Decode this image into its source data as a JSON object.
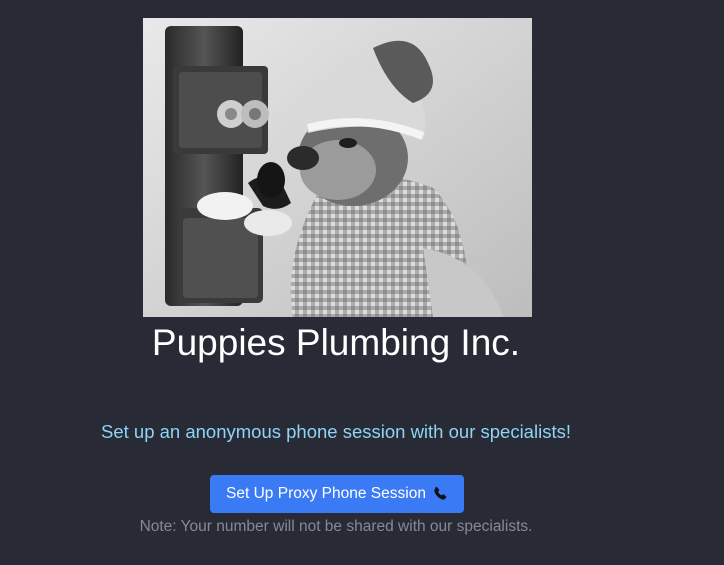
{
  "brand": {
    "title": "Puppies Plumbing Inc."
  },
  "hero": {
    "image_description_icon": "vintage-photo-dog-on-phone"
  },
  "main": {
    "tagline": "Set up an anonymous phone session with our specialists!",
    "button_label": "Set Up Proxy Phone Session",
    "button_icon": "phone-icon",
    "note": "Note: Your number will not be shared with our specialists."
  },
  "colors": {
    "background": "#282a36",
    "tagline": "#8fd3f5",
    "button": "#3a7bf5",
    "note": "#878a96"
  }
}
